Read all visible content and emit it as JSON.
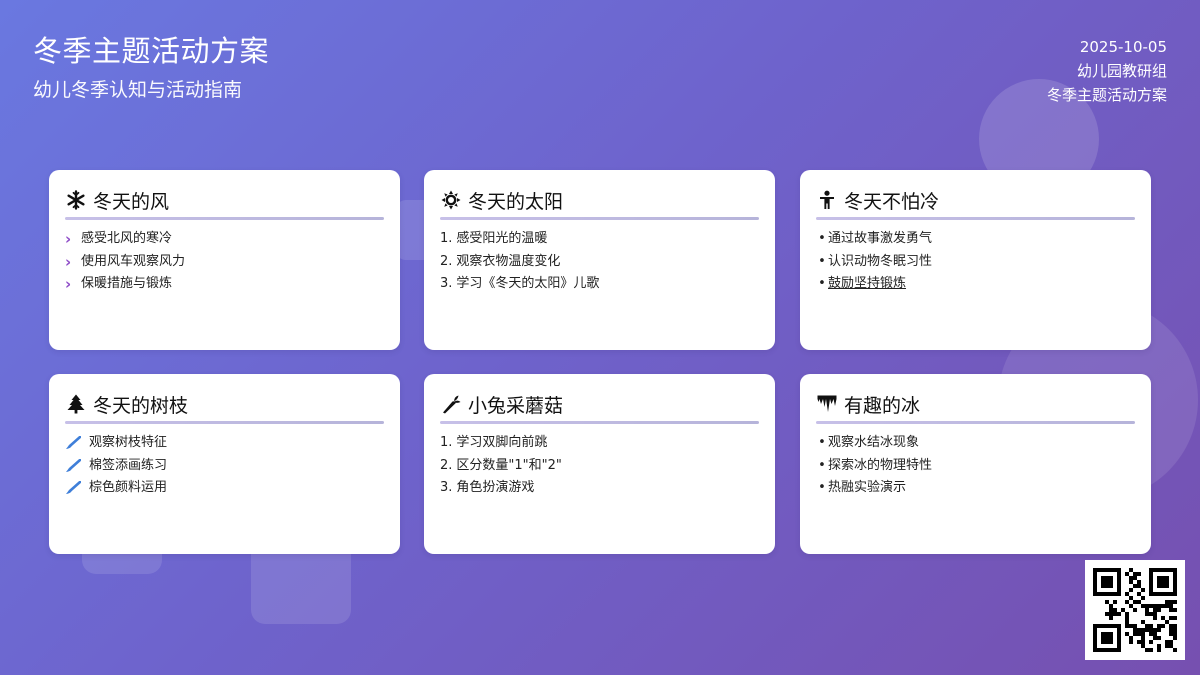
{
  "header": {
    "title": "冬季主题活动方案",
    "subtitle": "幼儿冬季认知与活动指南",
    "date": "2025-10-05",
    "org": "幼儿园教研组",
    "doc_name": "冬季主题活动方案"
  },
  "cards": [
    {
      "icon": "snowflake-icon",
      "title": "冬天的风",
      "marker": "chevron",
      "items": [
        "感受北风的寒冷",
        "使用风车观察风力",
        "保暖措施与锻炼"
      ]
    },
    {
      "icon": "sun-icon",
      "title": "冬天的太阳",
      "marker": "number",
      "items": [
        "感受阳光的温暖",
        "观察衣物温度变化",
        "学习《冬天的太阳》儿歌"
      ]
    },
    {
      "icon": "child-icon",
      "title": "冬天不怕冷",
      "marker": "bullet",
      "items": [
        "通过故事激发勇气",
        "认识动物冬眠习性",
        "鼓励坚持锻炼"
      ]
    },
    {
      "icon": "tree-icon",
      "title": "冬天的树枝",
      "marker": "brush",
      "items": [
        "观察树枝特征",
        "棉签添画练习",
        "棕色颜料运用"
      ]
    },
    {
      "icon": "carrot-icon",
      "title": "小兔采蘑菇",
      "marker": "number",
      "items": [
        "学习双脚向前跳",
        "区分数量\"1\"和\"2\"",
        "角色扮演游戏"
      ]
    },
    {
      "icon": "icicles-icon",
      "title": "有趣的冰",
      "marker": "bullet",
      "items": [
        "观察水结冰现象",
        "探索冰的物理特性",
        "热融实验演示"
      ]
    }
  ],
  "markers": {
    "chevron": "›",
    "bullet": "•",
    "num_1": "1.",
    "num_2": "2.",
    "num_3": "3."
  },
  "colors": {
    "background_start": "#6a78e0",
    "background_end": "#7650b0",
    "card": "#ffffff",
    "chevron": "#8e4cc8",
    "brush": "#3f7fd9"
  },
  "qr_code": {
    "icon": "qr-code-icon"
  }
}
